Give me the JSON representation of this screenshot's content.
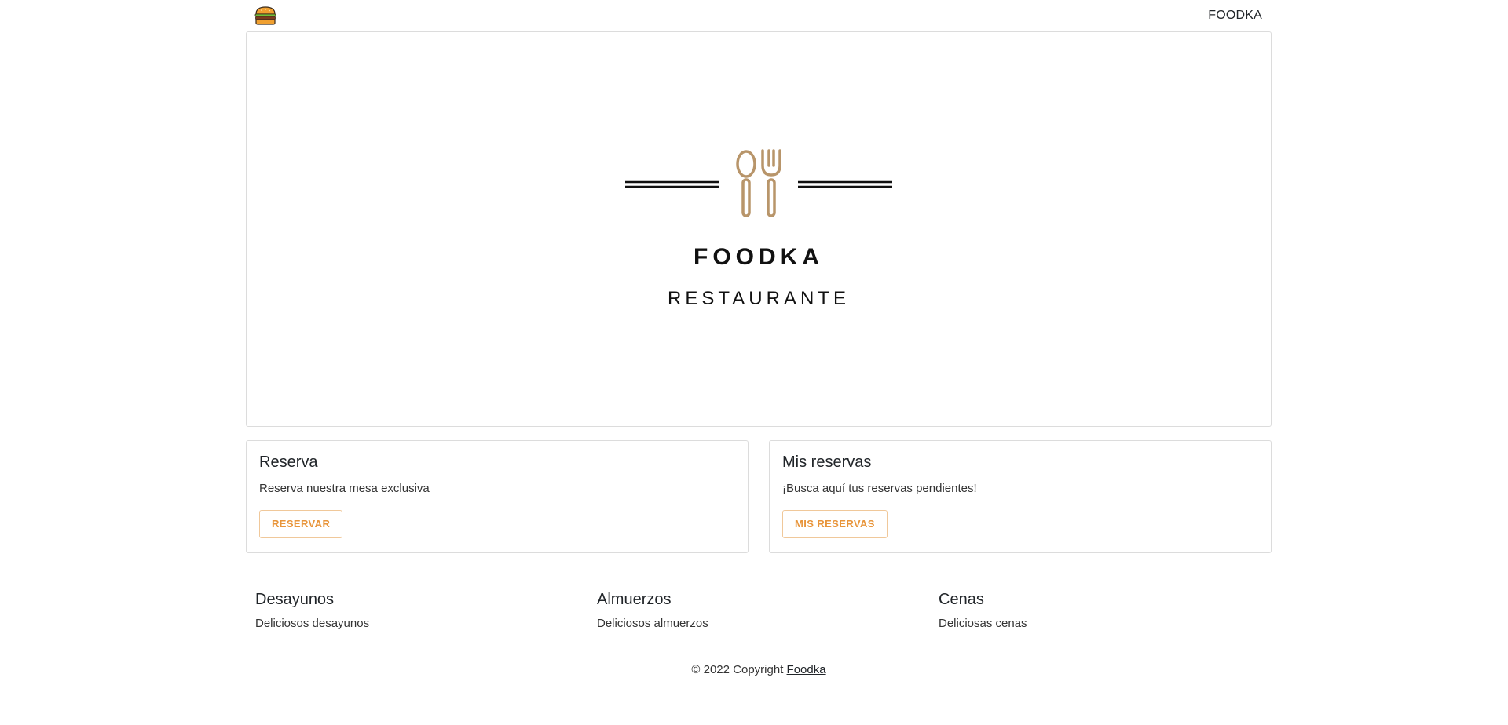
{
  "navbar": {
    "brand_icon": "hamburger-icon",
    "link_label": "FOODKA"
  },
  "hero": {
    "emblem_icon": "spoon-fork-icon",
    "accent_color": "#b8956a",
    "title": "FOODKA",
    "subtitle": "RESTAURANTE"
  },
  "cards": [
    {
      "title": "Reserva",
      "text": "Reserva nuestra mesa exclusiva",
      "button_label": "RESERVAR"
    },
    {
      "title": "Mis reservas",
      "text": "¡Busca aquí tus reservas pendientes!",
      "button_label": "MIS RESERVAS"
    }
  ],
  "button_color": "#e8953b",
  "categories": [
    {
      "title": "Desayunos",
      "text": "Deliciosos desayunos"
    },
    {
      "title": "Almuerzos",
      "text": "Deliciosos almuerzos"
    },
    {
      "title": "Cenas",
      "text": "Deliciosas cenas"
    }
  ],
  "footer": {
    "copyright_text": "© 2022 Copyright ",
    "link_label": "Foodka"
  }
}
